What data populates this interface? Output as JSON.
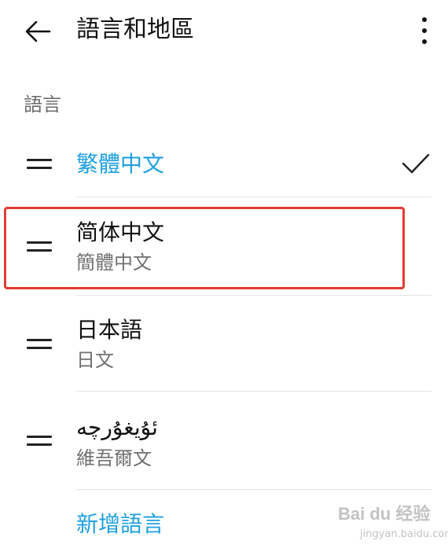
{
  "header": {
    "title": "語言和地區",
    "back_icon": "arrow-left-icon",
    "more_icon": "more-vertical-icon"
  },
  "section": {
    "label": "語言"
  },
  "languages": [
    {
      "name": "繁體中文",
      "subtitle": "",
      "selected": true
    },
    {
      "name": "简体中文",
      "subtitle": "簡體中文",
      "selected": false,
      "highlighted": true
    },
    {
      "name": "日本語",
      "subtitle": "日文",
      "selected": false
    },
    {
      "name": "ئۇيغۇرچە",
      "subtitle": "維吾爾文",
      "selected": false
    }
  ],
  "add_language": {
    "label": "新增語言"
  },
  "watermark": {
    "text": "Bai du 经验",
    "sub": "jingyan.baidu.com"
  },
  "colors": {
    "accent": "#1ea0e0",
    "highlight_border": "#e53b34"
  }
}
